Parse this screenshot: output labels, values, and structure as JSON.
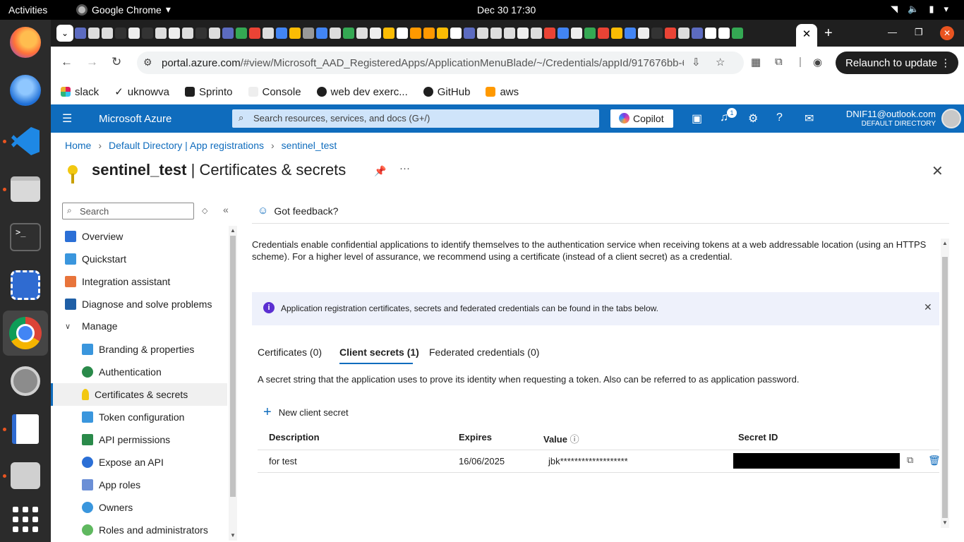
{
  "os": {
    "activities": "Activities",
    "app_name": "Google Chrome",
    "clock": "Dec 30  17:30"
  },
  "chrome": {
    "url_host": "portal.azure.com",
    "url_path": "/#view/Microsoft_AAD_RegisteredApps/ApplicationMenuBlade/~/Credentials/appId/917676bb-6...",
    "relaunch": "Relaunch to update",
    "bookmarks": [
      "slack",
      "uknowva",
      "Sprinto",
      "Console",
      "web dev exerc...",
      "GitHub",
      "aws"
    ]
  },
  "azure": {
    "brand": "Microsoft Azure",
    "search_placeholder": "Search resources, services, and docs (G+/)",
    "copilot": "Copilot",
    "notif_count": "1",
    "account_email": "DNIF11@outlook.com",
    "account_dir": "DEFAULT DIRECTORY"
  },
  "breadcrumb": [
    "Home",
    "Default Directory | App registrations",
    "sentinel_test"
  ],
  "page": {
    "title_app": "sentinel_test",
    "title_sep": " | ",
    "title_blade": "Certificates & secrets"
  },
  "nav": {
    "search_placeholder": "Search",
    "items": [
      {
        "label": "Overview",
        "color": "#2b6fd6"
      },
      {
        "label": "Quickstart",
        "color": "#3a96dd"
      },
      {
        "label": "Integration assistant",
        "color": "#e8743b"
      },
      {
        "label": "Diagnose and solve problems",
        "color": "#1f5fa6"
      },
      {
        "label": "Manage",
        "color": ""
      },
      {
        "label": "Branding & properties",
        "color": "#3a96dd"
      },
      {
        "label": "Authentication",
        "color": "#2a8a4a"
      },
      {
        "label": "Certificates & secrets",
        "color": "#f2c811"
      },
      {
        "label": "Token configuration",
        "color": "#3a96dd"
      },
      {
        "label": "API permissions",
        "color": "#2a8a4a"
      },
      {
        "label": "Expose an API",
        "color": "#2b6fd6"
      },
      {
        "label": "App roles",
        "color": "#6b8fd6"
      },
      {
        "label": "Owners",
        "color": "#3a96dd"
      },
      {
        "label": "Roles and administrators",
        "color": "#5fb85f"
      }
    ]
  },
  "main": {
    "feedback": "Got feedback?",
    "intro": "Credentials enable confidential applications to identify themselves to the authentication service when receiving tokens at a web addressable location (using an HTTPS scheme). For a higher level of assurance, we recommend using a certificate (instead of a client secret) as a credential.",
    "info": "Application registration certificates, secrets and federated credentials can be found in the tabs below.",
    "tabs": [
      "Certificates (0)",
      "Client secrets (1)",
      "Federated credentials (0)"
    ],
    "tab_description": "A secret string that the application uses to prove its identity when requesting a token. Also can be referred to as application password.",
    "new_secret": "New client secret",
    "table": {
      "headers": [
        "Description",
        "Expires",
        "Value",
        "Secret ID"
      ],
      "rows": [
        {
          "description": "for test",
          "expires": "16/06/2025",
          "value": "jbk*******************",
          "secret_id": ""
        }
      ]
    }
  }
}
